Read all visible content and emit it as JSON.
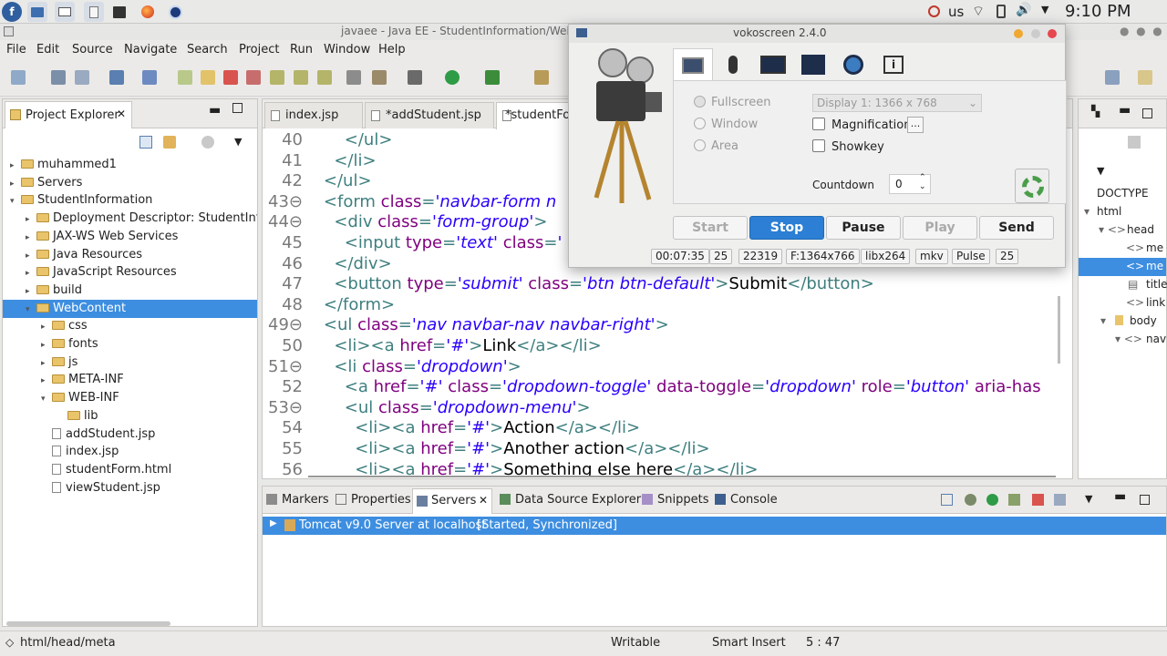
{
  "topbar": {
    "keyboard": "us",
    "clock": "9:10 PM"
  },
  "window_title": "javaee - Java EE - StudentInformation/WebC",
  "menu": [
    "File",
    "Edit",
    "Source",
    "Navigate",
    "Search",
    "Project",
    "Run",
    "Window",
    "Help"
  ],
  "project_explorer": {
    "title": "Project Explorer",
    "items": [
      {
        "label": "muhammed1",
        "depth": 0,
        "kind": "project",
        "arrow": "▸"
      },
      {
        "label": "Servers",
        "depth": 0,
        "kind": "folder",
        "arrow": "▸"
      },
      {
        "label": "StudentInformation",
        "depth": 0,
        "kind": "project",
        "arrow": "▾"
      },
      {
        "label": "Deployment Descriptor: StudentInfor",
        "depth": 1,
        "kind": "descriptor",
        "arrow": "▸"
      },
      {
        "label": "JAX-WS Web Services",
        "depth": 1,
        "kind": "ws",
        "arrow": "▸"
      },
      {
        "label": "Java Resources",
        "depth": 1,
        "kind": "res",
        "arrow": "▸"
      },
      {
        "label": "JavaScript Resources",
        "depth": 1,
        "kind": "res",
        "arrow": "▸"
      },
      {
        "label": "build",
        "depth": 1,
        "kind": "folder",
        "arrow": "▸"
      },
      {
        "label": "WebContent",
        "depth": 1,
        "kind": "folder",
        "arrow": "▾",
        "selected": true
      },
      {
        "label": "css",
        "depth": 2,
        "kind": "folder",
        "arrow": "▸"
      },
      {
        "label": "fonts",
        "depth": 2,
        "kind": "folder",
        "arrow": "▸"
      },
      {
        "label": "js",
        "depth": 2,
        "kind": "folder",
        "arrow": "▸"
      },
      {
        "label": "META-INF",
        "depth": 2,
        "kind": "folder",
        "arrow": "▸"
      },
      {
        "label": "WEB-INF",
        "depth": 2,
        "kind": "folder",
        "arrow": "▾"
      },
      {
        "label": "lib",
        "depth": 3,
        "kind": "folder",
        "arrow": ""
      },
      {
        "label": "addStudent.jsp",
        "depth": 2,
        "kind": "file",
        "arrow": ""
      },
      {
        "label": "index.jsp",
        "depth": 2,
        "kind": "file",
        "arrow": ""
      },
      {
        "label": "studentForm.html",
        "depth": 2,
        "kind": "file",
        "arrow": ""
      },
      {
        "label": "viewStudent.jsp",
        "depth": 2,
        "kind": "file",
        "arrow": ""
      }
    ]
  },
  "editor": {
    "tabs": [
      {
        "label": "index.jsp",
        "active": false
      },
      {
        "label": "*addStudent.jsp",
        "active": false
      },
      {
        "label": "*studentFor",
        "active": true
      }
    ],
    "lines": [
      {
        "n": "40",
        "segs": [
          [
            "t",
            "      </ul>"
          ]
        ]
      },
      {
        "n": "41",
        "segs": [
          [
            "t",
            "    </li>"
          ]
        ]
      },
      {
        "n": "42",
        "segs": [
          [
            "t",
            "  </ul>"
          ]
        ]
      },
      {
        "n": "43⊖",
        "segs": [
          [
            "t",
            "  <form "
          ],
          [
            "a",
            "class"
          ],
          [
            "t",
            "="
          ],
          [
            "s",
            "'navbar-form n"
          ]
        ]
      },
      {
        "n": "44⊖",
        "segs": [
          [
            "t",
            "    <div "
          ],
          [
            "a",
            "class"
          ],
          [
            "t",
            "="
          ],
          [
            "s",
            "'form-group'"
          ],
          [
            "t",
            ">"
          ]
        ]
      },
      {
        "n": "45",
        "segs": [
          [
            "t",
            "      <input "
          ],
          [
            "a",
            "type"
          ],
          [
            "t",
            "="
          ],
          [
            "s",
            "'text'"
          ],
          [
            "t",
            " "
          ],
          [
            "a",
            "class"
          ],
          [
            "t",
            "="
          ],
          [
            "s",
            "'"
          ]
        ]
      },
      {
        "n": "46",
        "segs": [
          [
            "t",
            "    </div>"
          ]
        ]
      },
      {
        "n": "47",
        "segs": [
          [
            "t",
            "    <button "
          ],
          [
            "a",
            "type"
          ],
          [
            "t",
            "="
          ],
          [
            "s",
            "'submit'"
          ],
          [
            "t",
            " "
          ],
          [
            "a",
            "class"
          ],
          [
            "t",
            "="
          ],
          [
            "s",
            "'btn btn-default'"
          ],
          [
            "t",
            ">"
          ],
          [
            "x",
            "Submit"
          ],
          [
            "t",
            "</button>"
          ]
        ]
      },
      {
        "n": "48",
        "segs": [
          [
            "t",
            "  </form>"
          ]
        ]
      },
      {
        "n": "49⊖",
        "segs": [
          [
            "t",
            "  <ul "
          ],
          [
            "a",
            "class"
          ],
          [
            "t",
            "="
          ],
          [
            "s",
            "'nav navbar-nav navbar-right'"
          ],
          [
            "t",
            ">"
          ]
        ]
      },
      {
        "n": "50",
        "segs": [
          [
            "t",
            "    <li><a "
          ],
          [
            "a",
            "href"
          ],
          [
            "t",
            "="
          ],
          [
            "s",
            "'#'"
          ],
          [
            "t",
            ">"
          ],
          [
            "x",
            "Link"
          ],
          [
            "t",
            "</a></li>"
          ]
        ]
      },
      {
        "n": "51⊖",
        "segs": [
          [
            "t",
            "    <li "
          ],
          [
            "a",
            "class"
          ],
          [
            "t",
            "="
          ],
          [
            "s",
            "'dropdown'"
          ],
          [
            "t",
            ">"
          ]
        ]
      },
      {
        "n": "52",
        "segs": [
          [
            "t",
            "      <a "
          ],
          [
            "a",
            "href"
          ],
          [
            "t",
            "="
          ],
          [
            "s",
            "'#'"
          ],
          [
            "t",
            " "
          ],
          [
            "a",
            "class"
          ],
          [
            "t",
            "="
          ],
          [
            "s",
            "'dropdown-toggle'"
          ],
          [
            "t",
            " "
          ],
          [
            "a",
            "data-toggle"
          ],
          [
            "t",
            "="
          ],
          [
            "s",
            "'dropdown'"
          ],
          [
            "t",
            " "
          ],
          [
            "a",
            "role"
          ],
          [
            "t",
            "="
          ],
          [
            "s",
            "'button'"
          ],
          [
            "t",
            " "
          ],
          [
            "a",
            "aria-has"
          ]
        ]
      },
      {
        "n": "53⊖",
        "segs": [
          [
            "t",
            "      <ul "
          ],
          [
            "a",
            "class"
          ],
          [
            "t",
            "="
          ],
          [
            "s",
            "'dropdown-menu'"
          ],
          [
            "t",
            ">"
          ]
        ]
      },
      {
        "n": "54",
        "segs": [
          [
            "t",
            "        <li><a "
          ],
          [
            "a",
            "href"
          ],
          [
            "t",
            "="
          ],
          [
            "s",
            "'#'"
          ],
          [
            "t",
            ">"
          ],
          [
            "x",
            "Action"
          ],
          [
            "t",
            "</a></li>"
          ]
        ]
      },
      {
        "n": "55",
        "segs": [
          [
            "t",
            "        <li><a "
          ],
          [
            "a",
            "href"
          ],
          [
            "t",
            "="
          ],
          [
            "s",
            "'#'"
          ],
          [
            "t",
            ">"
          ],
          [
            "x",
            "Another action"
          ],
          [
            "t",
            "</a></li>"
          ]
        ]
      },
      {
        "n": "56",
        "segs": [
          [
            "t",
            "        <li><a "
          ],
          [
            "a",
            "href"
          ],
          [
            "t",
            "="
          ],
          [
            "s",
            "'#'"
          ],
          [
            "t",
            ">"
          ],
          [
            "x",
            "Something else here"
          ],
          [
            "t",
            "</a></li>"
          ]
        ]
      }
    ]
  },
  "outline": {
    "items": [
      "DOCTYPE",
      "html",
      "head",
      "me",
      "me",
      "title",
      "link",
      "body",
      "nav"
    ]
  },
  "bottom_panel": {
    "tabs": [
      "Markers",
      "Properties",
      "Servers",
      "Data Source Explorer",
      "Snippets",
      "Console"
    ],
    "server_row": "Tomcat v9.0 Server at localhost",
    "server_state": "[Started, Synchronized]"
  },
  "vokoscreen": {
    "title": "vokoscreen 2.4.0",
    "modes": [
      "Fullscreen",
      "Window",
      "Area"
    ],
    "display": "Display 1:  1366 x 768",
    "magnification_label": "Magnification",
    "magnification_btn": "...",
    "showkey_label": "Showkey",
    "countdown_label": "Countdown",
    "countdown_value": "0",
    "buttons": [
      "Start",
      "Stop",
      "Pause",
      "Play",
      "Send"
    ],
    "status": [
      "00:07:35",
      "25",
      "22319",
      "F:1364x766",
      "libx264",
      "mkv",
      "Pulse",
      "25"
    ]
  },
  "statusbar": {
    "path": "html/head/meta",
    "mode": "Writable",
    "insert": "Smart Insert",
    "position": "5 : 47"
  }
}
